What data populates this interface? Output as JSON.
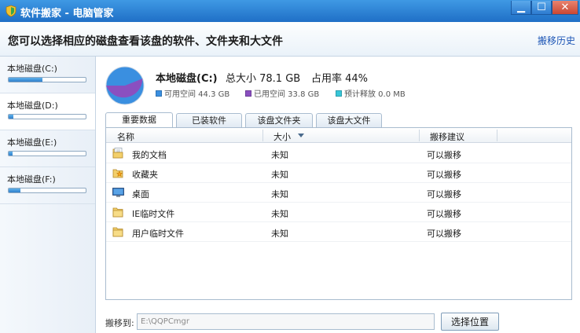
{
  "window": {
    "title": "软件搬家 - 电脑管家",
    "minimize_glyph": "▁",
    "maximize_glyph": "☐",
    "close_glyph": "✕"
  },
  "header": {
    "title": "您可以选择相应的磁盘查看该盘的软件、文件夹和大文件",
    "history_link": "搬移历史"
  },
  "sidebar": {
    "disks": [
      {
        "label": "本地磁盘(C:)",
        "usage_percent": 44
      },
      {
        "label": "本地磁盘(D:)",
        "usage_percent": 6
      },
      {
        "label": "本地磁盘(E:)",
        "usage_percent": 5
      },
      {
        "label": "本地磁盘(F:)",
        "usage_percent": 15
      }
    ],
    "selected_index": 1
  },
  "disk_info": {
    "name": "本地磁盘(C:)",
    "total": "总大小 78.1 GB",
    "usage": "占用率 44%",
    "used_fraction": 0.44,
    "legend": {
      "free": "可用空间 44.3 GB",
      "used": "已用空间 33.8 GB",
      "release": "预计释放 0.0 MB"
    },
    "colors": {
      "free": "#3a8fe0",
      "used": "#8a4fc0",
      "release": "#37c6d8"
    }
  },
  "tabs": [
    "重要数据",
    "已装软件",
    "该盘文件夹",
    "该盘大文件"
  ],
  "active_tab": 0,
  "table": {
    "columns": [
      "名称",
      "大小",
      "搬移建议"
    ],
    "rows": [
      {
        "icon": "documents-folder-icon",
        "name": "我的文档",
        "size": "未知",
        "advice": "可以搬移"
      },
      {
        "icon": "favorites-folder-icon",
        "name": "收藏夹",
        "size": "未知",
        "advice": "可以搬移"
      },
      {
        "icon": "desktop-icon",
        "name": "桌面",
        "size": "未知",
        "advice": "可以搬移"
      },
      {
        "icon": "folder-icon",
        "name": "IE临时文件",
        "size": "未知",
        "advice": "可以搬移"
      },
      {
        "icon": "folder-icon",
        "name": "用户临时文件",
        "size": "未知",
        "advice": "可以搬移"
      }
    ]
  },
  "move_to": {
    "label": "搬移到:",
    "path": "E:\\QQPCmgr",
    "choose_button": "选择位置"
  }
}
